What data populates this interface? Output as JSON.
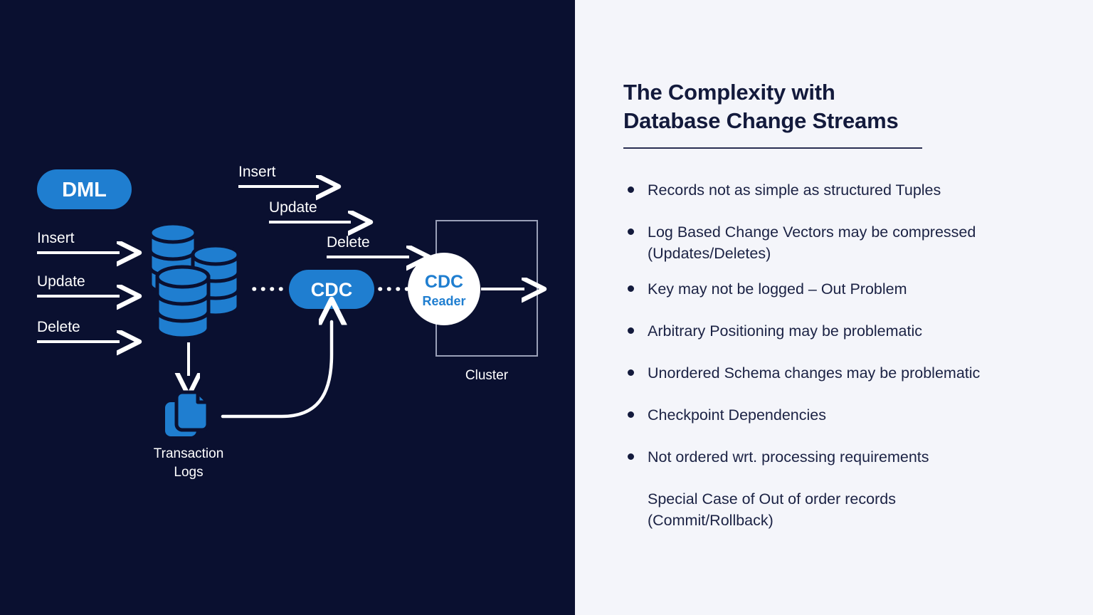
{
  "colors": {
    "panel_dark": "#0a1030",
    "panel_light": "#f4f5fa",
    "accent_blue": "#1f7ed0",
    "ink": "#131a3c",
    "white": "#ffffff"
  },
  "diagram": {
    "dml_badge": "DML",
    "source_ops": [
      "Insert",
      "Update",
      "Delete"
    ],
    "stream_ops": [
      "Insert",
      "Update",
      "Delete"
    ],
    "db_stack_label": "",
    "cdc_node": "CDC",
    "cdc_reader_line1": "CDC",
    "cdc_reader_line2": "Reader",
    "cluster_label": "Cluster",
    "transaction_logs_label": "Transaction\nLogs"
  },
  "content": {
    "title_line1": "The Complexity with",
    "title_line2": "Database Change Streams",
    "bullets": [
      {
        "text": "Records not as simple as structured Tuples",
        "bulleted": true,
        "spacing": "loose"
      },
      {
        "text": "Log Based Change Vectors may be compressed\n(Updates/Deletes)",
        "bulleted": true,
        "spacing": "tight"
      },
      {
        "text": "Key may not be logged – Out Problem",
        "bulleted": true,
        "spacing": "loose"
      },
      {
        "text": "Arbitrary Positioning may be problematic",
        "bulleted": true,
        "spacing": "loose"
      },
      {
        "text": "Unordered Schema changes may be problematic",
        "bulleted": true,
        "spacing": "loose"
      },
      {
        "text": "Checkpoint Dependencies",
        "bulleted": true,
        "spacing": "loose"
      },
      {
        "text": "Not ordered wrt. processing requirements",
        "bulleted": true,
        "spacing": "loose"
      },
      {
        "text": "Special Case of Out of order records\n(Commit/Rollback)",
        "bulleted": false,
        "spacing": "tight"
      }
    ]
  }
}
